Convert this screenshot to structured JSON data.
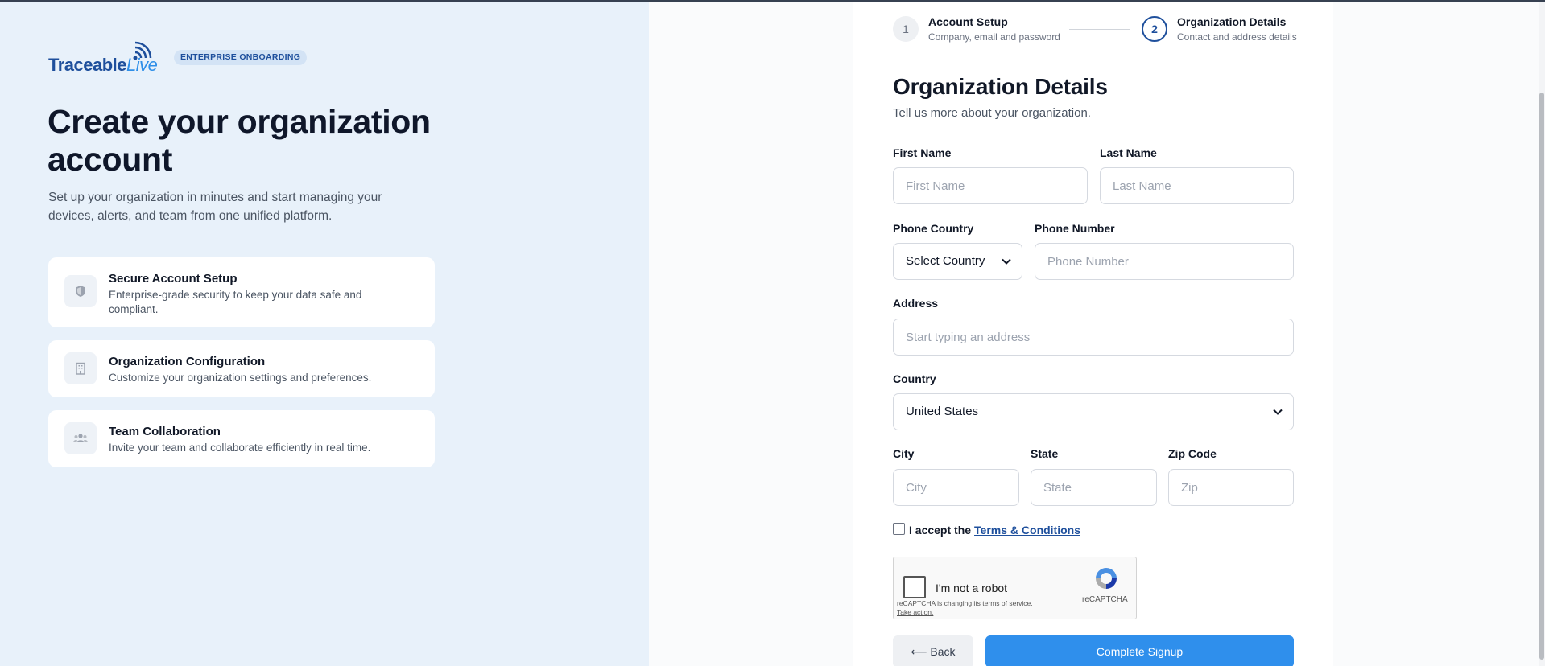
{
  "brand": {
    "logo_main": "Traceable",
    "logo_live": "Live",
    "badge": "ENTERPRISE ONBOARDING"
  },
  "hero": {
    "title": "Create your organization account",
    "subtitle": "Set up your organization in minutes and start managing your devices, alerts, and team from one unified platform."
  },
  "features": [
    {
      "icon": "shield-icon",
      "title": "Secure Account Setup",
      "description": "Enterprise-grade security to keep your data safe and compliant."
    },
    {
      "icon": "building-icon",
      "title": "Organization Configuration",
      "description": "Customize your organization settings and preferences."
    },
    {
      "icon": "users-icon",
      "title": "Team Collaboration",
      "description": "Invite your team and collaborate efficiently in real time."
    }
  ],
  "stepper": {
    "steps": [
      {
        "number": "1",
        "title": "Account Setup",
        "subtitle": "Company, email and password"
      },
      {
        "number": "2",
        "title": "Organization Details",
        "subtitle": "Contact and address details"
      }
    ]
  },
  "form": {
    "title": "Organization Details",
    "subtitle": "Tell us more about your organization.",
    "first_name": {
      "label": "First Name",
      "placeholder": "First Name",
      "value": ""
    },
    "last_name": {
      "label": "Last Name",
      "placeholder": "Last Name",
      "value": ""
    },
    "phone_country": {
      "label": "Phone Country",
      "value": "Select Country"
    },
    "phone_number": {
      "label": "Phone Number",
      "placeholder": "Phone Number",
      "value": ""
    },
    "address": {
      "label": "Address",
      "placeholder": "Start typing an address",
      "value": ""
    },
    "country": {
      "label": "Country",
      "value": "United States"
    },
    "city": {
      "label": "City",
      "placeholder": "City",
      "value": ""
    },
    "state": {
      "label": "State",
      "placeholder": "State",
      "value": ""
    },
    "zip": {
      "label": "Zip Code",
      "placeholder": "Zip",
      "value": ""
    },
    "terms": {
      "prefix": "I accept the",
      "link": "Terms & Conditions"
    },
    "recaptcha": {
      "label": "I'm not a robot",
      "brand": "reCAPTCHA",
      "note": "reCAPTCHA is changing its terms of service.",
      "action": "Take action."
    },
    "back_label": "⟵ Back",
    "submit_label": "Complete Signup"
  },
  "colors": {
    "primary": "#2f8fec",
    "brand_dark": "#1e4f9c",
    "left_bg": "#e8f1fa"
  }
}
